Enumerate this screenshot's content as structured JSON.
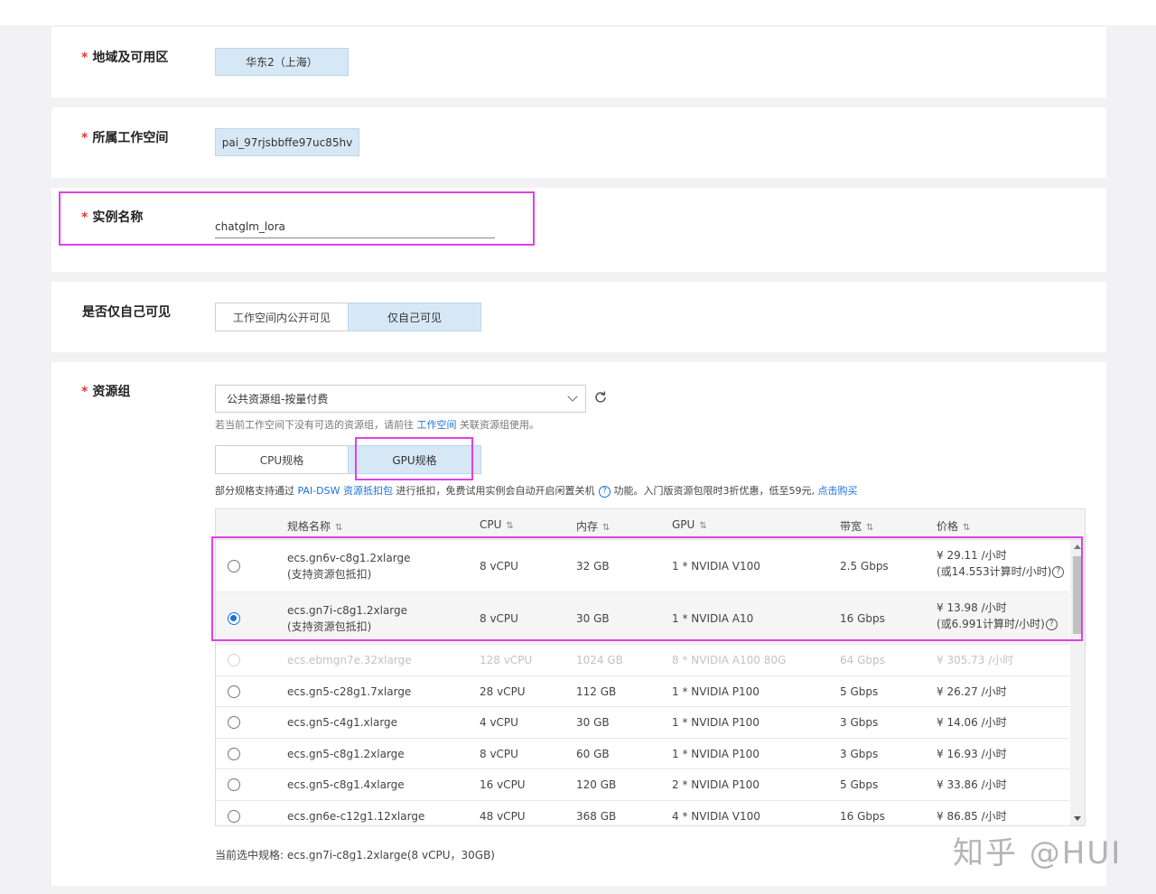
{
  "region": {
    "label": "地域及可用区",
    "value": "华东2（上海）"
  },
  "workspace": {
    "label": "所属工作空间",
    "value": "pai_97rjsbbffe97uc85hv"
  },
  "instance": {
    "label": "实例名称",
    "value": "chatglm_lora"
  },
  "visibility": {
    "label": "是否仅自己可见",
    "options": [
      "工作空间内公开可见",
      "仅自己可见"
    ],
    "selected": "仅自己可见"
  },
  "resource": {
    "label": "资源组",
    "select_value": "公共资源组-按量付费",
    "hint_prefix": "若当前工作空间下没有可选的资源组，请前往",
    "hint_link": "工作空间",
    "hint_suffix": "关联资源组使用。",
    "tabs": [
      "CPU规格",
      "GPU规格"
    ],
    "active_tab": "GPU规格",
    "notice_prefix": "部分规格支持通过",
    "notice_link": "PAI-DSW 资源抵扣包",
    "notice_mid": "进行抵扣，免费试用实例会自动开启闲置关机",
    "notice_suffix": "功能。入门版资源包限时3折优惠，低至59元,",
    "notice_buy": "点击购买",
    "columns": [
      "规格名称",
      "CPU",
      "内存",
      "GPU",
      "带宽",
      "价格"
    ],
    "sort_icon": "⇅",
    "rows": [
      {
        "name": "ecs.gn6v-c8g1.2xlarge",
        "note": "(支持资源包抵扣)",
        "cpu": "8 vCPU",
        "mem": "32 GB",
        "gpu": "1 * NVIDIA V100",
        "bw": "2.5 Gbps",
        "price": "¥ 29.11 /小时",
        "price2": "(或14.553计算时/小时)",
        "state": "normal"
      },
      {
        "name": "ecs.gn7i-c8g1.2xlarge",
        "note": "(支持资源包抵扣)",
        "cpu": "8 vCPU",
        "mem": "30 GB",
        "gpu": "1 * NVIDIA A10",
        "bw": "16 Gbps",
        "price": "¥ 13.98 /小时",
        "price2": "(或6.991计算时/小时)",
        "state": "selected"
      },
      {
        "name": "ecs.ebmgn7e.32xlarge",
        "cpu": "128 vCPU",
        "mem": "1024 GB",
        "gpu": "8 * NVIDIA A100 80G",
        "bw": "64 Gbps",
        "price": "¥ 305.73 /小时",
        "state": "disabled"
      },
      {
        "name": "ecs.gn5-c28g1.7xlarge",
        "cpu": "28 vCPU",
        "mem": "112 GB",
        "gpu": "1 * NVIDIA P100",
        "bw": "5 Gbps",
        "price": "¥ 26.27 /小时",
        "state": "normal"
      },
      {
        "name": "ecs.gn5-c4g1.xlarge",
        "cpu": "4 vCPU",
        "mem": "30 GB",
        "gpu": "1 * NVIDIA P100",
        "bw": "3 Gbps",
        "price": "¥ 14.06 /小时",
        "state": "normal"
      },
      {
        "name": "ecs.gn5-c8g1.2xlarge",
        "cpu": "8 vCPU",
        "mem": "60 GB",
        "gpu": "1 * NVIDIA P100",
        "bw": "3 Gbps",
        "price": "¥ 16.93 /小时",
        "state": "normal"
      },
      {
        "name": "ecs.gn5-c8g1.4xlarge",
        "cpu": "16 vCPU",
        "mem": "120 GB",
        "gpu": "2 * NVIDIA P100",
        "bw": "5 Gbps",
        "price": "¥ 33.86 /小时",
        "state": "normal"
      },
      {
        "name": "ecs.gn6e-c12g1.12xlarge",
        "cpu": "48 vCPU",
        "mem": "368 GB",
        "gpu": "4 * NVIDIA V100",
        "bw": "16 Gbps",
        "price": "¥ 86.85 /小时",
        "state": "normal"
      }
    ],
    "current_selection": "当前选中规格: ecs.gn7i-c8g1.2xlarge(8 vCPU，30GB)"
  },
  "icons": {
    "required_mark": "*",
    "help": "?",
    "refresh": "refresh-icon",
    "dropdown": "chevron-down-icon"
  },
  "watermark": "知乎 @HUI",
  "colors": {
    "accent": "#1a73d9",
    "highlight": "#e040e6",
    "tag_bg": "#d6e8f6",
    "required": "#e5392f"
  }
}
